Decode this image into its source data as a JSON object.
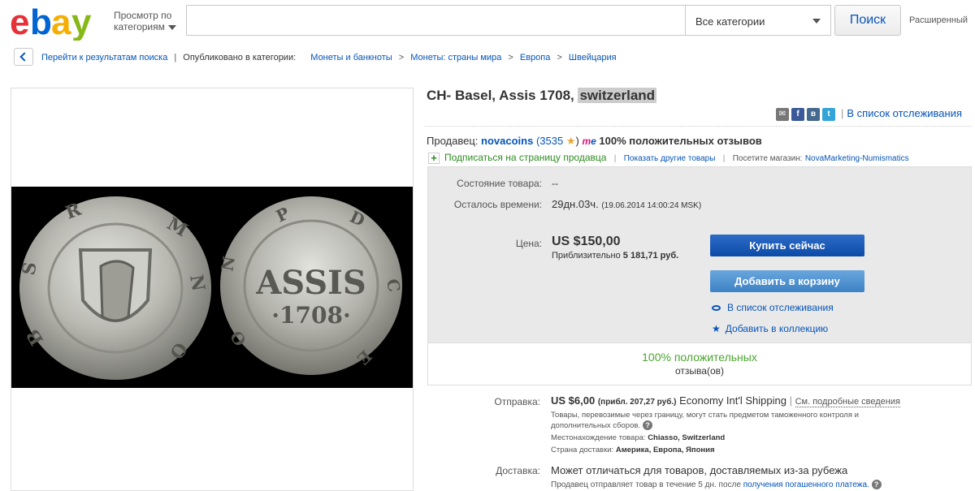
{
  "header": {
    "logo_letters": [
      "e",
      "b",
      "a",
      "y"
    ],
    "logo_colors": [
      "#e53238",
      "#0064d2",
      "#f5af02",
      "#86b817"
    ],
    "browse_line1": "Просмотр по",
    "browse_line2": "категориям",
    "search_value": "",
    "category_selected": "Все категории",
    "search_button": "Поиск",
    "advanced": "Расширенный"
  },
  "breadcrumb": {
    "back_label": "Перейти к результатам поиска",
    "published_in": "Опубликовано в категории:",
    "items": [
      "Монеты и банкноты",
      "Монеты: страны мира",
      "Европа",
      "Швейцария"
    ]
  },
  "listing": {
    "title_main": "CH- Basel, Assis 1708, ",
    "title_highlight": "switzerland",
    "watch_list_link": "В список отслеживания",
    "share_icons": [
      "mail-icon",
      "facebook-icon",
      "vkontakte-icon",
      "twitter-icon"
    ]
  },
  "seller": {
    "label": "Продавец:",
    "name": "novacoins",
    "feedback_open": "(3535",
    "me_badge": "m",
    "me_badge_b": "e",
    "positive": "100% положительных отзывов",
    "follow": "Подписаться на страницу продавца",
    "other_items": "Показать другие товары",
    "store_label": "Посетите магазин:",
    "store_name": "NovaMarketing-Numismatics"
  },
  "buybox": {
    "condition_label": "Состояние товара:",
    "condition_value": "--",
    "time_label": "Осталось времени:",
    "time_value": "29дн.03ч.",
    "time_end": "(19.06.2014   14:00:24 MSK)",
    "price_label": "Цена:",
    "price_value": "US $150,00",
    "approx_label": "Приблизительно",
    "approx_value": "5 181,71 руб.",
    "buy_now": "Купить сейчас",
    "add_to_cart": "Добавить в корзину",
    "watch": "В список отслеживания",
    "add_collection": "Добавить в коллекцию",
    "feedback_pct": "100% положительных",
    "feedback_sub": "отзыва(ов)"
  },
  "shipping": {
    "label": "Отправка:",
    "cost": "US $6,00",
    "approx": "(прибл. 207,27 руб.)",
    "method": "Economy Int'l Shipping",
    "details_link": "См. подробные сведения",
    "note": "Товары, перевозимые через границу, могут стать предметом таможенного контроля и дополнительных сборов.",
    "location_label": "Местонахождение товара:",
    "location_value": "Chiasso, Switzerland",
    "countries_label": "Страна доставки:",
    "countries_value": "Америка, Европа, Япония"
  },
  "delivery": {
    "label": "Доставка:",
    "text": "Может отличаться для товаров, доставляемых из-за рубежа",
    "note": "Продавец отправляет товар в течение 5 дн. после",
    "note_link": "получения погашенного платежа."
  }
}
